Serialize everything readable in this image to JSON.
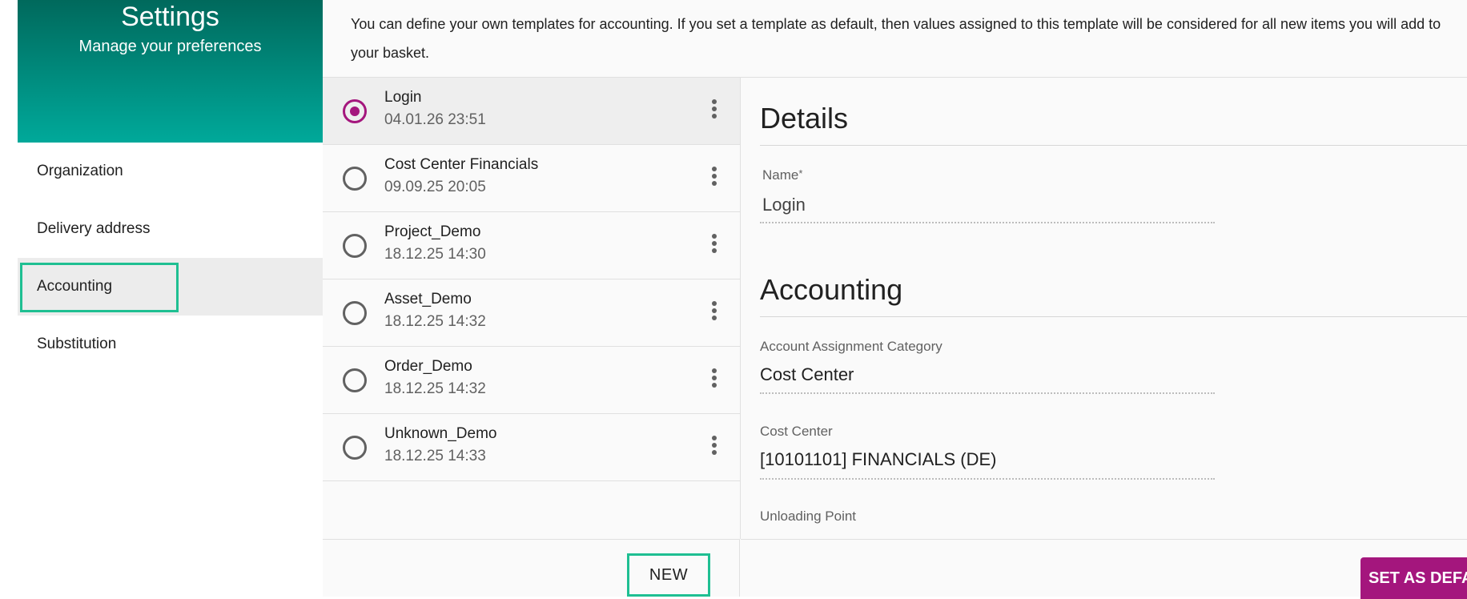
{
  "sidebar": {
    "title": "Settings",
    "subtitle": "Manage your preferences",
    "items": [
      {
        "label": "Organization"
      },
      {
        "label": "Delivery address"
      },
      {
        "label": "Accounting"
      },
      {
        "label": "Substitution"
      }
    ],
    "active_item": "Accounting"
  },
  "main": {
    "info_text": "You can define your own templates for accounting. If you set a template as default, then values assigned to this template will be considered for all new items you will add to your basket."
  },
  "templates": [
    {
      "name": "Login",
      "date": "04.01.26 23:51",
      "selected": true
    },
    {
      "name": "Cost Center Financials",
      "date": "09.09.25 20:05",
      "selected": false
    },
    {
      "name": "Project_Demo",
      "date": "18.12.25 14:30",
      "selected": false
    },
    {
      "name": "Asset_Demo",
      "date": "18.12.25 14:32",
      "selected": false
    },
    {
      "name": "Order_Demo",
      "date": "18.12.25 14:32",
      "selected": false
    },
    {
      "name": "Unknown_Demo",
      "date": "18.12.25 14:33",
      "selected": false
    }
  ],
  "list_footer": {
    "new_label": "NEW"
  },
  "details": {
    "title": "Details",
    "name_label": "Name",
    "name_required_mark": "*",
    "name_value": "Login",
    "accounting_title": "Accounting",
    "account_assignment_label": "Account Assignment Category",
    "account_assignment_value": "Cost Center",
    "cost_center_label": "Cost Center",
    "cost_center_value": "[10101101] FINANCIALS (DE)",
    "unloading_point_label": "Unloading Point"
  },
  "details_footer": {
    "set_default_label": "SET AS DEFA"
  },
  "colors": {
    "header_teal": "#00897b",
    "accent_magenta": "#a4167d",
    "highlight_green": "#1fbf92"
  }
}
